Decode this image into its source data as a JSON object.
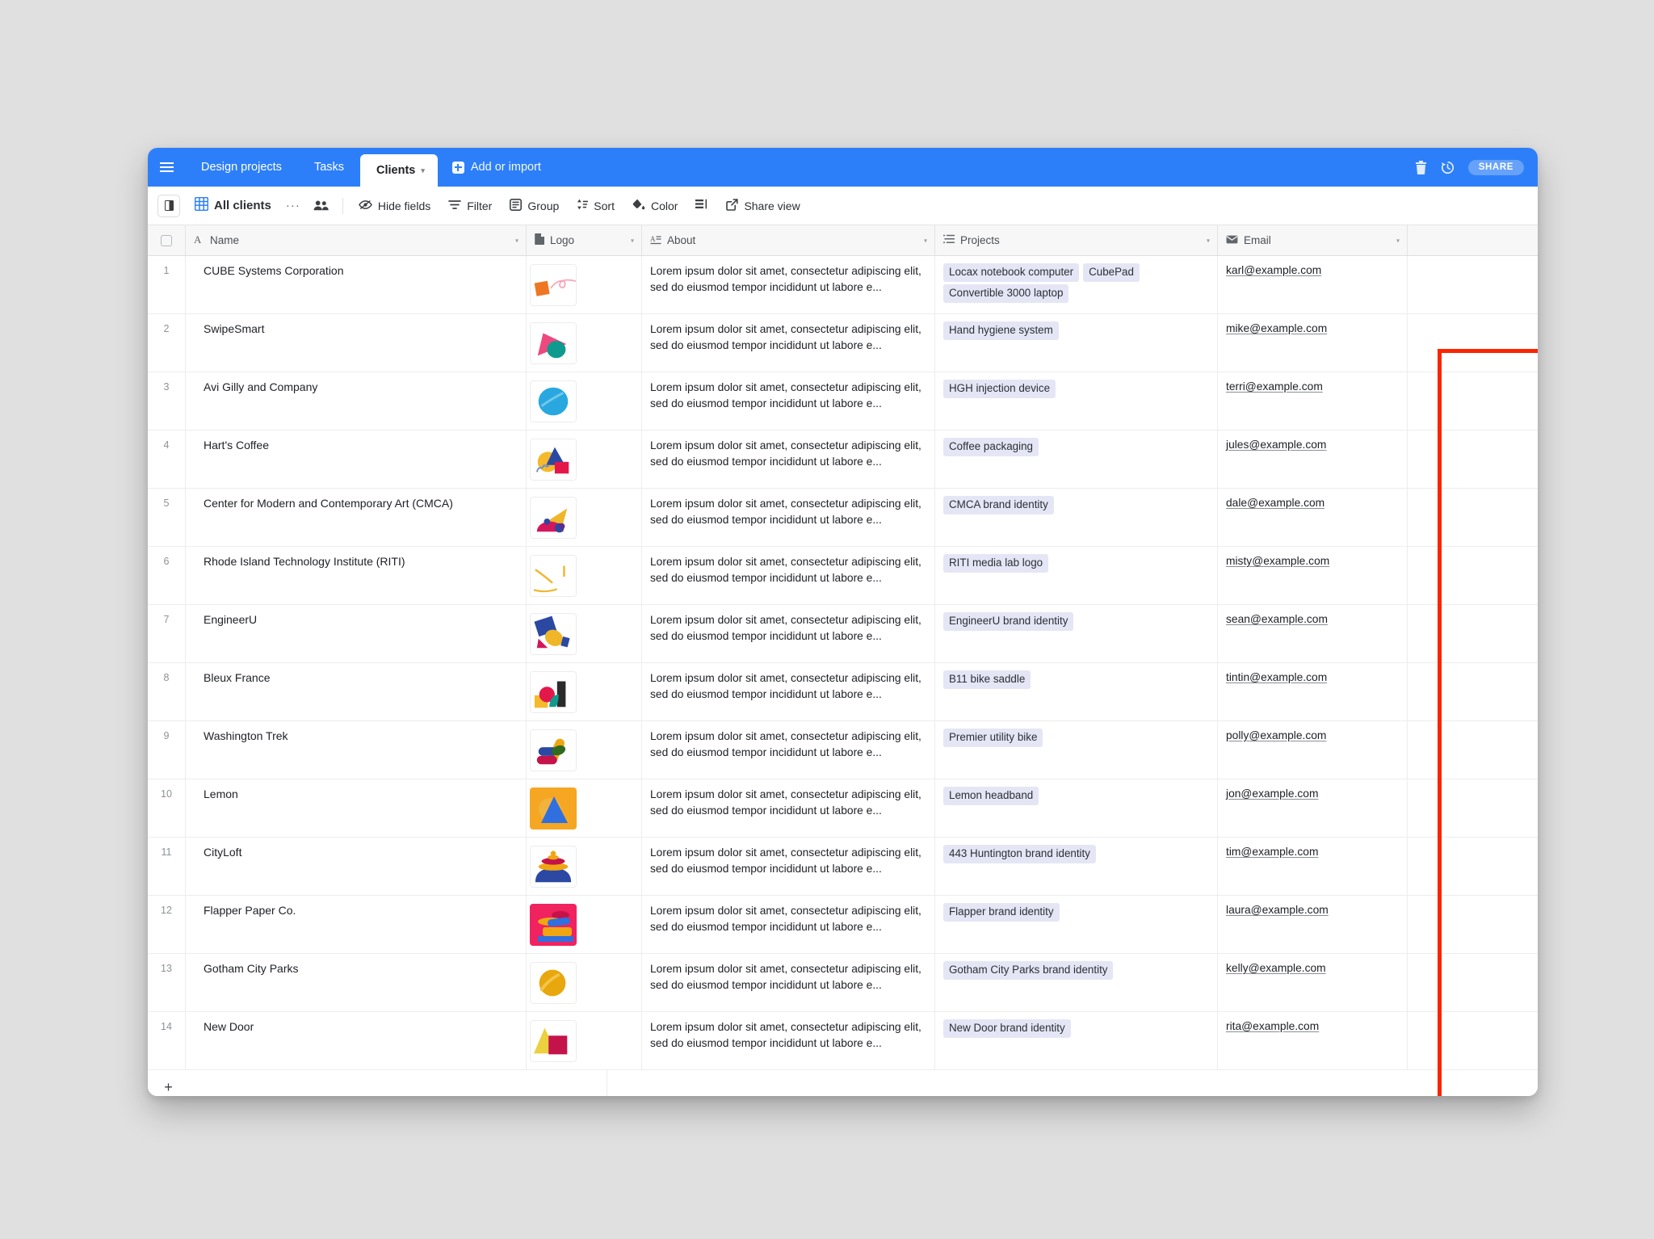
{
  "window": {
    "topbar": {
      "menu_icon": "hamburger-icon",
      "tabs": [
        {
          "label": "Design projects",
          "active": false
        },
        {
          "label": "Tasks",
          "active": false
        },
        {
          "label": "Clients",
          "active": true,
          "caret": "▾"
        }
      ],
      "add_or_import": "Add or import",
      "trash_icon": "trash-icon",
      "history_icon": "history-icon",
      "share_label": "SHARE"
    },
    "toolbar": {
      "sidebar_toggle_icon": "panel-toggle-icon",
      "grid_icon": "grid-view-icon",
      "view_name": "All clients",
      "more_options": "···",
      "collaborators_icon": "collaborators-icon",
      "items": [
        {
          "label": "Hide fields",
          "icon": "eye-slash-icon"
        },
        {
          "label": "Filter",
          "icon": "filter-icon"
        },
        {
          "label": "Group",
          "icon": "group-icon"
        },
        {
          "label": "Sort",
          "icon": "sort-icon"
        },
        {
          "label": "Color",
          "icon": "paint-bucket-icon"
        },
        {
          "label": "",
          "icon": "row-height-icon"
        },
        {
          "label": "Share view",
          "icon": "share-view-icon"
        }
      ]
    },
    "grid": {
      "columns": [
        {
          "key": "check",
          "label": "",
          "icon": "checkbox-icon",
          "caret": ""
        },
        {
          "key": "name",
          "label": "Name",
          "icon": "text-field-icon",
          "caret": "▾"
        },
        {
          "key": "logo",
          "label": "Logo",
          "icon": "attachment-icon",
          "caret": "▾"
        },
        {
          "key": "about",
          "label": "About",
          "icon": "long-text-icon",
          "caret": "▾"
        },
        {
          "key": "projects",
          "label": "Projects",
          "icon": "linked-record-icon",
          "caret": "▾"
        },
        {
          "key": "email",
          "label": "Email",
          "icon": "email-icon",
          "caret": "▾"
        }
      ],
      "about_text": "Lorem ipsum dolor sit amet, consectetur adipiscing elit, sed do eiusmod tempor incididunt ut labore e...",
      "rows": [
        {
          "num": "1",
          "name": "CUBE Systems Corporation",
          "logo": "logo-cube",
          "projects": [
            "Locax notebook computer",
            "CubePad",
            "Convertible 3000 laptop"
          ],
          "email": "karl@example.com"
        },
        {
          "num": "2",
          "name": "SwipeSmart",
          "logo": "logo-swipesmart",
          "projects": [
            "Hand hygiene system"
          ],
          "email": "mike@example.com"
        },
        {
          "num": "3",
          "name": "Avi Gilly and Company",
          "logo": "logo-avigilly",
          "projects": [
            "HGH injection device"
          ],
          "email": "terri@example.com"
        },
        {
          "num": "4",
          "name": "Hart's Coffee",
          "logo": "logo-harts",
          "projects": [
            "Coffee packaging"
          ],
          "email": "jules@example.com"
        },
        {
          "num": "5",
          "name": "Center for Modern and Contemporary Art (CMCA)",
          "logo": "logo-cmca",
          "projects": [
            "CMCA brand identity"
          ],
          "email": "dale@example.com"
        },
        {
          "num": "6",
          "name": "Rhode Island Technology Institute (RITI)",
          "logo": "logo-riti",
          "projects": [
            "RITI media lab logo"
          ],
          "email": "misty@example.com"
        },
        {
          "num": "7",
          "name": "EngineerU",
          "logo": "logo-engineeru",
          "projects": [
            "EngineerU brand identity"
          ],
          "email": "sean@example.com"
        },
        {
          "num": "8",
          "name": "Bleux France",
          "logo": "logo-bleux",
          "projects": [
            "B11 bike saddle"
          ],
          "email": "tintin@example.com"
        },
        {
          "num": "9",
          "name": "Washington Trek",
          "logo": "logo-washington",
          "projects": [
            "Premier utility bike"
          ],
          "email": "polly@example.com"
        },
        {
          "num": "10",
          "name": "Lemon",
          "logo": "logo-lemon",
          "projects": [
            "Lemon headband"
          ],
          "email": "jon@example.com"
        },
        {
          "num": "11",
          "name": "CityLoft",
          "logo": "logo-cityloft",
          "projects": [
            "443 Huntington brand identity"
          ],
          "email": "tim@example.com"
        },
        {
          "num": "12",
          "name": "Flapper Paper Co.",
          "logo": "logo-flapper",
          "projects": [
            "Flapper brand identity"
          ],
          "email": "laura@example.com"
        },
        {
          "num": "13",
          "name": "Gotham City Parks",
          "logo": "logo-gotham",
          "projects": [
            "Gotham City Parks brand identity"
          ],
          "email": "kelly@example.com"
        },
        {
          "num": "14",
          "name": "New Door",
          "logo": "logo-newdoor",
          "projects": [
            "New Door brand identity"
          ],
          "email": "rita@example.com"
        }
      ],
      "add_row_label": "+"
    },
    "annotation": {
      "highlight_color": "#fc2400",
      "highlighted_column": "Email"
    },
    "colors": {
      "brand_blue": "#2d7ff9",
      "chip_bg": "#e4e6f5",
      "page_bg": "#e0e0e0"
    }
  }
}
